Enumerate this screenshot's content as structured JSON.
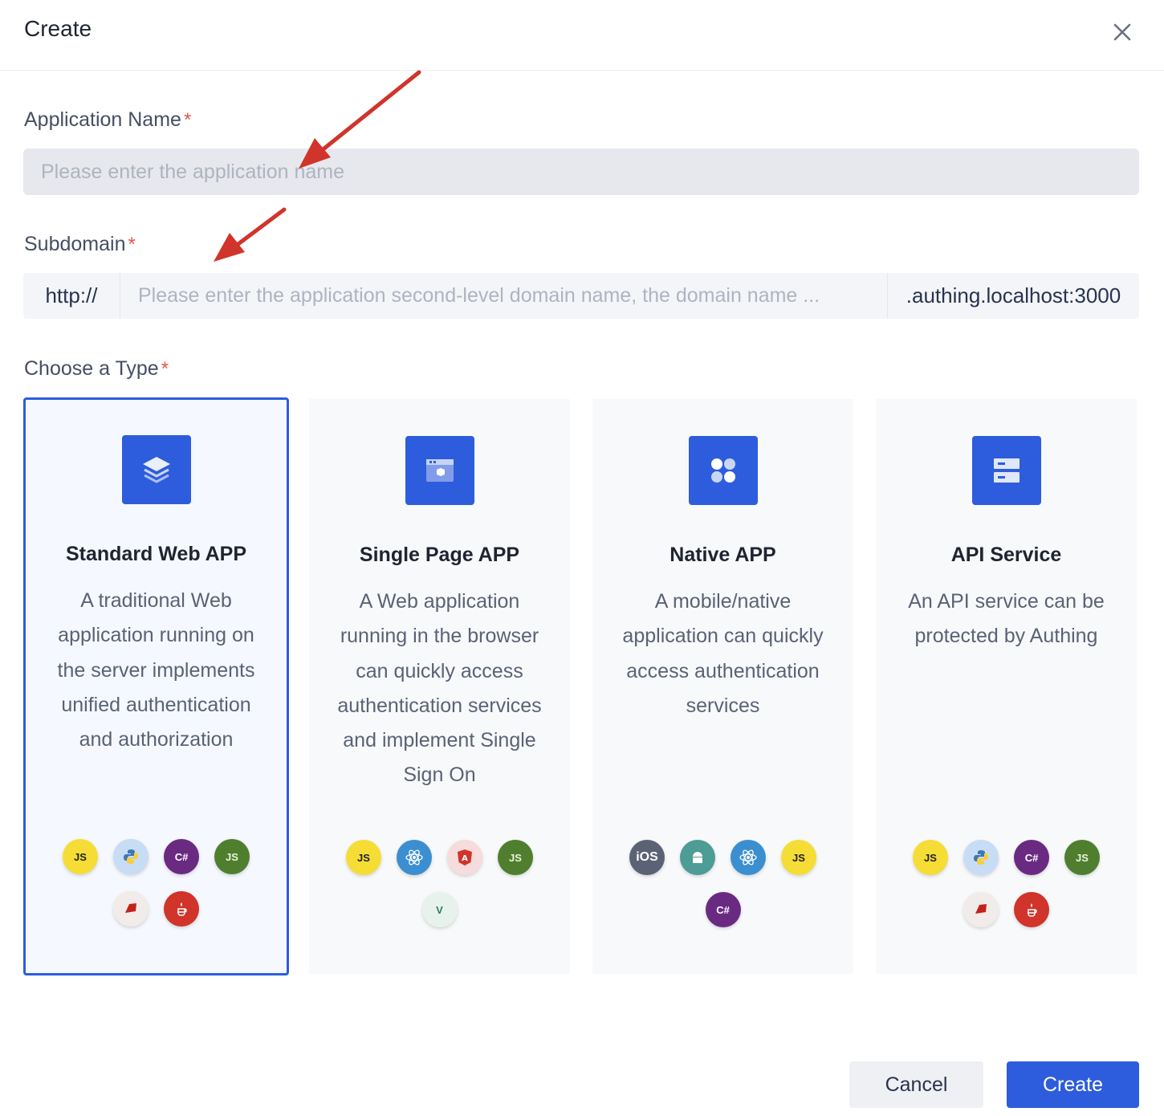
{
  "dialog": {
    "title": "Create"
  },
  "form": {
    "app_name": {
      "label": "Application Name",
      "required_mark": "*",
      "placeholder": "Please enter the application name",
      "value": ""
    },
    "subdomain": {
      "label": "Subdomain",
      "required_mark": "*",
      "prefix": "http://",
      "placeholder": "Please enter the application second-level domain name, the domain name ...",
      "suffix": ".authing.localhost:3000",
      "value": ""
    },
    "type": {
      "label": "Choose a Type",
      "required_mark": "*"
    }
  },
  "types": [
    {
      "title": "Standard Web APP",
      "description": "A traditional Web application running on the server implements unified authentication and authorization",
      "icon": "layers-icon",
      "selected": true,
      "techs": [
        {
          "label": "JS",
          "name": "javascript-icon"
        },
        {
          "label": "",
          "name": "python-icon"
        },
        {
          "label": "C#",
          "name": "csharp-icon"
        },
        {
          "label": "JS",
          "name": "nodejs-icon"
        },
        {
          "label": "",
          "name": "ruby-icon"
        },
        {
          "label": "",
          "name": "java-icon"
        }
      ]
    },
    {
      "title": "Single Page APP",
      "description": "A Web application running in the browser can quickly access authentication services and implement Single Sign On",
      "icon": "browser-window-icon",
      "selected": false,
      "techs": [
        {
          "label": "JS",
          "name": "javascript-icon"
        },
        {
          "label": "",
          "name": "react-icon"
        },
        {
          "label": "A",
          "name": "angular-icon"
        },
        {
          "label": "JS",
          "name": "nodejs-icon"
        },
        {
          "label": "V",
          "name": "vue-icon"
        }
      ]
    },
    {
      "title": "Native APP",
      "description": "A mobile/native application can quickly access authentication services",
      "icon": "apps-grid-icon",
      "selected": false,
      "techs": [
        {
          "label": "iOS",
          "name": "ios-icon"
        },
        {
          "label": "",
          "name": "android-icon"
        },
        {
          "label": "",
          "name": "react-icon"
        },
        {
          "label": "JS",
          "name": "javascript-icon"
        },
        {
          "label": "C#",
          "name": "csharp-icon"
        }
      ]
    },
    {
      "title": "API Service",
      "description": "An API service can be protected by Authing",
      "icon": "server-icon",
      "selected": false,
      "techs": [
        {
          "label": "JS",
          "name": "javascript-icon"
        },
        {
          "label": "",
          "name": "python-icon"
        },
        {
          "label": "C#",
          "name": "csharp-icon"
        },
        {
          "label": "JS",
          "name": "nodejs-icon"
        },
        {
          "label": "",
          "name": "ruby-icon"
        },
        {
          "label": "",
          "name": "java-icon"
        }
      ]
    }
  ],
  "footer": {
    "cancel_label": "Cancel",
    "create_label": "Create"
  },
  "colors": {
    "primary": "#2d5ddc",
    "required": "#e2574c",
    "annotation_arrow": "#d0342a"
  }
}
